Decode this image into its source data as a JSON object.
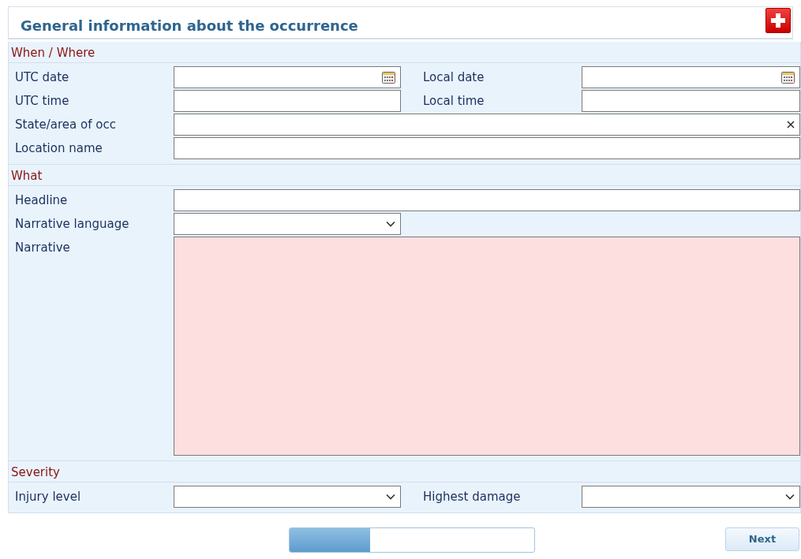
{
  "header": {
    "title": "General information about the occurrence"
  },
  "sections": [
    {
      "title": "When / Where",
      "rows": [
        {
          "fields": [
            {
              "label": "UTC date",
              "kind": "date"
            },
            {
              "label": "Local date",
              "kind": "date"
            }
          ]
        },
        {
          "fields": [
            {
              "label": "UTC time",
              "kind": "text"
            },
            {
              "label": "Local time",
              "kind": "text"
            }
          ]
        },
        {
          "fields": [
            {
              "label": "State/area of occ",
              "kind": "combo"
            }
          ]
        },
        {
          "fields": [
            {
              "label": "Location name",
              "kind": "text"
            }
          ]
        }
      ]
    },
    {
      "title": "What",
      "rows": [
        {
          "fields": [
            {
              "label": "Headline",
              "kind": "text"
            }
          ]
        },
        {
          "fields": [
            {
              "label": "Narrative language",
              "kind": "select"
            }
          ]
        },
        {
          "fields": [
            {
              "label": "Narrative",
              "kind": "textarea",
              "invalid": true
            }
          ]
        }
      ]
    },
    {
      "title": "Severity",
      "rows": [
        {
          "fields": [
            {
              "label": "Injury level",
              "kind": "select"
            },
            {
              "label": "Highest damage",
              "kind": "select"
            }
          ]
        }
      ]
    }
  ],
  "progress": {
    "level": 0.33
  },
  "next_button": "Next"
}
